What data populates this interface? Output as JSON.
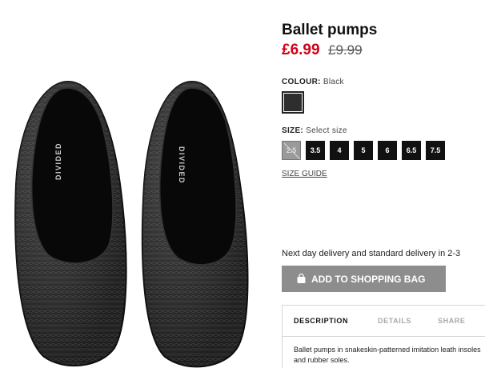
{
  "product": {
    "title": "Ballet pumps",
    "price_current": "£6.99",
    "price_original": "£9.99",
    "image_brand_text": "DIVIDED"
  },
  "colour": {
    "label": "COLOUR:",
    "value": "Black",
    "swatch_color": "#2e2e2e"
  },
  "size": {
    "label": "SIZE:",
    "placeholder": "Select size",
    "options": [
      "2.5",
      "3.5",
      "4",
      "5",
      "6",
      "6.5",
      "7.5"
    ],
    "unavailable": [
      "2.5"
    ],
    "guide_label": "SIZE GUIDE"
  },
  "delivery": {
    "text": "Next day delivery and standard delivery in 2-3"
  },
  "actions": {
    "add_to_bag_label": "ADD TO SHOPPING BAG",
    "bag_icon": "shopping-bag-icon"
  },
  "tabs": [
    {
      "label": "DESCRIPTION",
      "active": true
    },
    {
      "label": "DETAILS",
      "active": false
    },
    {
      "label": "SHARE",
      "active": false
    }
  ],
  "description": {
    "text": "Ballet pumps in snakeskin-patterned imitation leath insoles and rubber soles."
  },
  "colors": {
    "sale_red": "#d0021b",
    "button_grey": "#8d8d8d",
    "size_black": "#111111"
  }
}
